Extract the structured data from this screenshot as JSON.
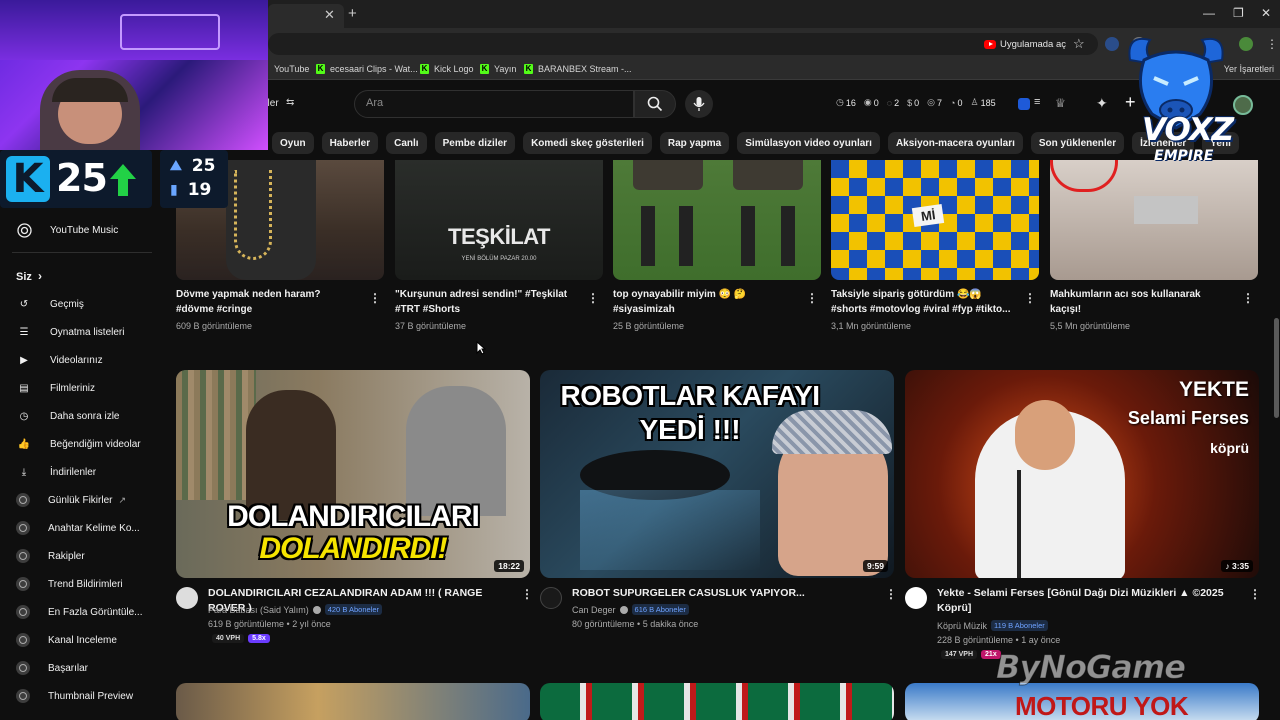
{
  "browser": {
    "bookmarks": [
      {
        "label": "YouTube",
        "type": "yt"
      },
      {
        "label": "ecesaari Clips - Wat...",
        "type": "kick"
      },
      {
        "label": "Kick Logo",
        "type": "kick"
      },
      {
        "label": "Yayın",
        "type": "kick"
      },
      {
        "label": "BARANBEX Stream -...",
        "type": "kick"
      }
    ],
    "bookmarks_right": "Yer İşaretleri",
    "app_chip": "Uygulamada aç"
  },
  "header": {
    "left_label": "eler",
    "search_placeholder": "Ara",
    "stats": [
      {
        "icon": "clock-icon",
        "value": "16"
      },
      {
        "icon": "eye-icon",
        "value": "0"
      },
      {
        "icon": "comment-icon",
        "value": "2"
      },
      {
        "icon": "dollar-icon",
        "value": "0"
      },
      {
        "icon": "view-icon",
        "value": "7"
      },
      {
        "icon": "timer-icon",
        "value": "0"
      },
      {
        "icon": "people-icon",
        "value": "185"
      }
    ]
  },
  "chips": [
    "Oyun",
    "Haberler",
    "Canlı",
    "Pembe diziler",
    "Komedi skeç gösterileri",
    "Rap yapma",
    "Simülasyon video oyunları",
    "Aksiyon-macera oyunları",
    "Son yüklenenler",
    "İzlenenler",
    "Yeni"
  ],
  "sidebar": {
    "top_item": "YouTube Music",
    "you_heading": "Siz",
    "you_chevron": "›",
    "items": [
      {
        "label": "Geçmiş",
        "icon": "history-icon"
      },
      {
        "label": "Oynatma listeleri",
        "icon": "playlist-icon"
      },
      {
        "label": "Videolarınız",
        "icon": "video-icon"
      },
      {
        "label": "Filmleriniz",
        "icon": "film-icon"
      },
      {
        "label": "Daha sonra izle",
        "icon": "clock-icon"
      },
      {
        "label": "Beğendiğim videolar",
        "icon": "thumbs-up-icon"
      },
      {
        "label": "İndirilenler",
        "icon": "download-icon"
      }
    ],
    "extensions": [
      {
        "label": "Günlük Fikirler"
      },
      {
        "label": "Anahtar Kelime Ko..."
      },
      {
        "label": "Rakipler"
      },
      {
        "label": "Trend Bildirimleri"
      },
      {
        "label": "En Fazla Görüntüle..."
      },
      {
        "label": "Kanal Inceleme"
      },
      {
        "label": "Başarılar"
      },
      {
        "label": "Thumbnail Preview"
      }
    ]
  },
  "shorts": [
    {
      "title": "Dövme yapmak neden haram? #dövme #cringe",
      "views": "609 B görüntüleme"
    },
    {
      "title": "\"Kurşunun adresi sendin!\" #Teşkilat #TRT #Shorts",
      "views": "37 B görüntüleme",
      "thumb_text": "TEŞKİLAT",
      "thumb_sub": "YENİ BÖLÜM PAZAR 20.00"
    },
    {
      "title": "top oynayabilir miyim 😳 🤔 #siyasimizah",
      "views": "25 B görüntüleme"
    },
    {
      "title": "Taksiyle sipariş götürdüm 😂😱 #shorts #motovlog #viral #fyp #tikto...",
      "views": "3,1 Mn görüntüleme",
      "thumb_text": "Mİ"
    },
    {
      "title": "Mahkumların acı sos kullanarak kaçışı!",
      "views": "5,5 Mn görüntüleme"
    }
  ],
  "videos": [
    {
      "title": "DOLANDIRICILARI CEZALANDIRAN ADAM !!! ( RANGE ROVER )",
      "channel": "Para Babası (Said Yalım)",
      "subs": "420 B Aboneler",
      "meta": "619 B görüntüleme • 2 yıl önce",
      "duration": "18:22",
      "thumb_line1": "DOLANDIRICILARI",
      "thumb_line2": "DOLANDIRDI!",
      "vph": "40 VPH",
      "mult": "5.8x",
      "mult_color": "#6b3cff"
    },
    {
      "title": "ROBOT SUPURGELER CASUSLUK YAPIYOR...",
      "channel": "Can Deger",
      "subs": "616 B Aboneler",
      "meta": "80 görüntüleme • 5 dakika önce",
      "duration": "9:59",
      "thumb_line1": "ROBOTLAR KAFAYI",
      "thumb_line2": "YEDİ !!!"
    },
    {
      "title": "Yekte - Selami Ferses [Gönül Dağı Dizi Müzikleri ▲ ©2025 Köprü]",
      "channel": "Köprü Müzik",
      "subs": "119 B Aboneler",
      "meta": "228 B görüntüleme • 1 ay önce",
      "duration": "3:35",
      "thumb_line1": "YEKTE",
      "thumb_line2": "Selami Ferses",
      "thumb_brand": "köprü",
      "vph": "147 VPH",
      "mult": "21x",
      "mult_color": "#c0166a"
    }
  ],
  "bottom_row_text": "MOTORU YOK",
  "overlays": {
    "kick_followers": "25",
    "stat_top": "25",
    "stat_bottom": "19",
    "voxz": "VOXZ",
    "empire": "EMPIRE",
    "watermark": "ByNoGame"
  }
}
